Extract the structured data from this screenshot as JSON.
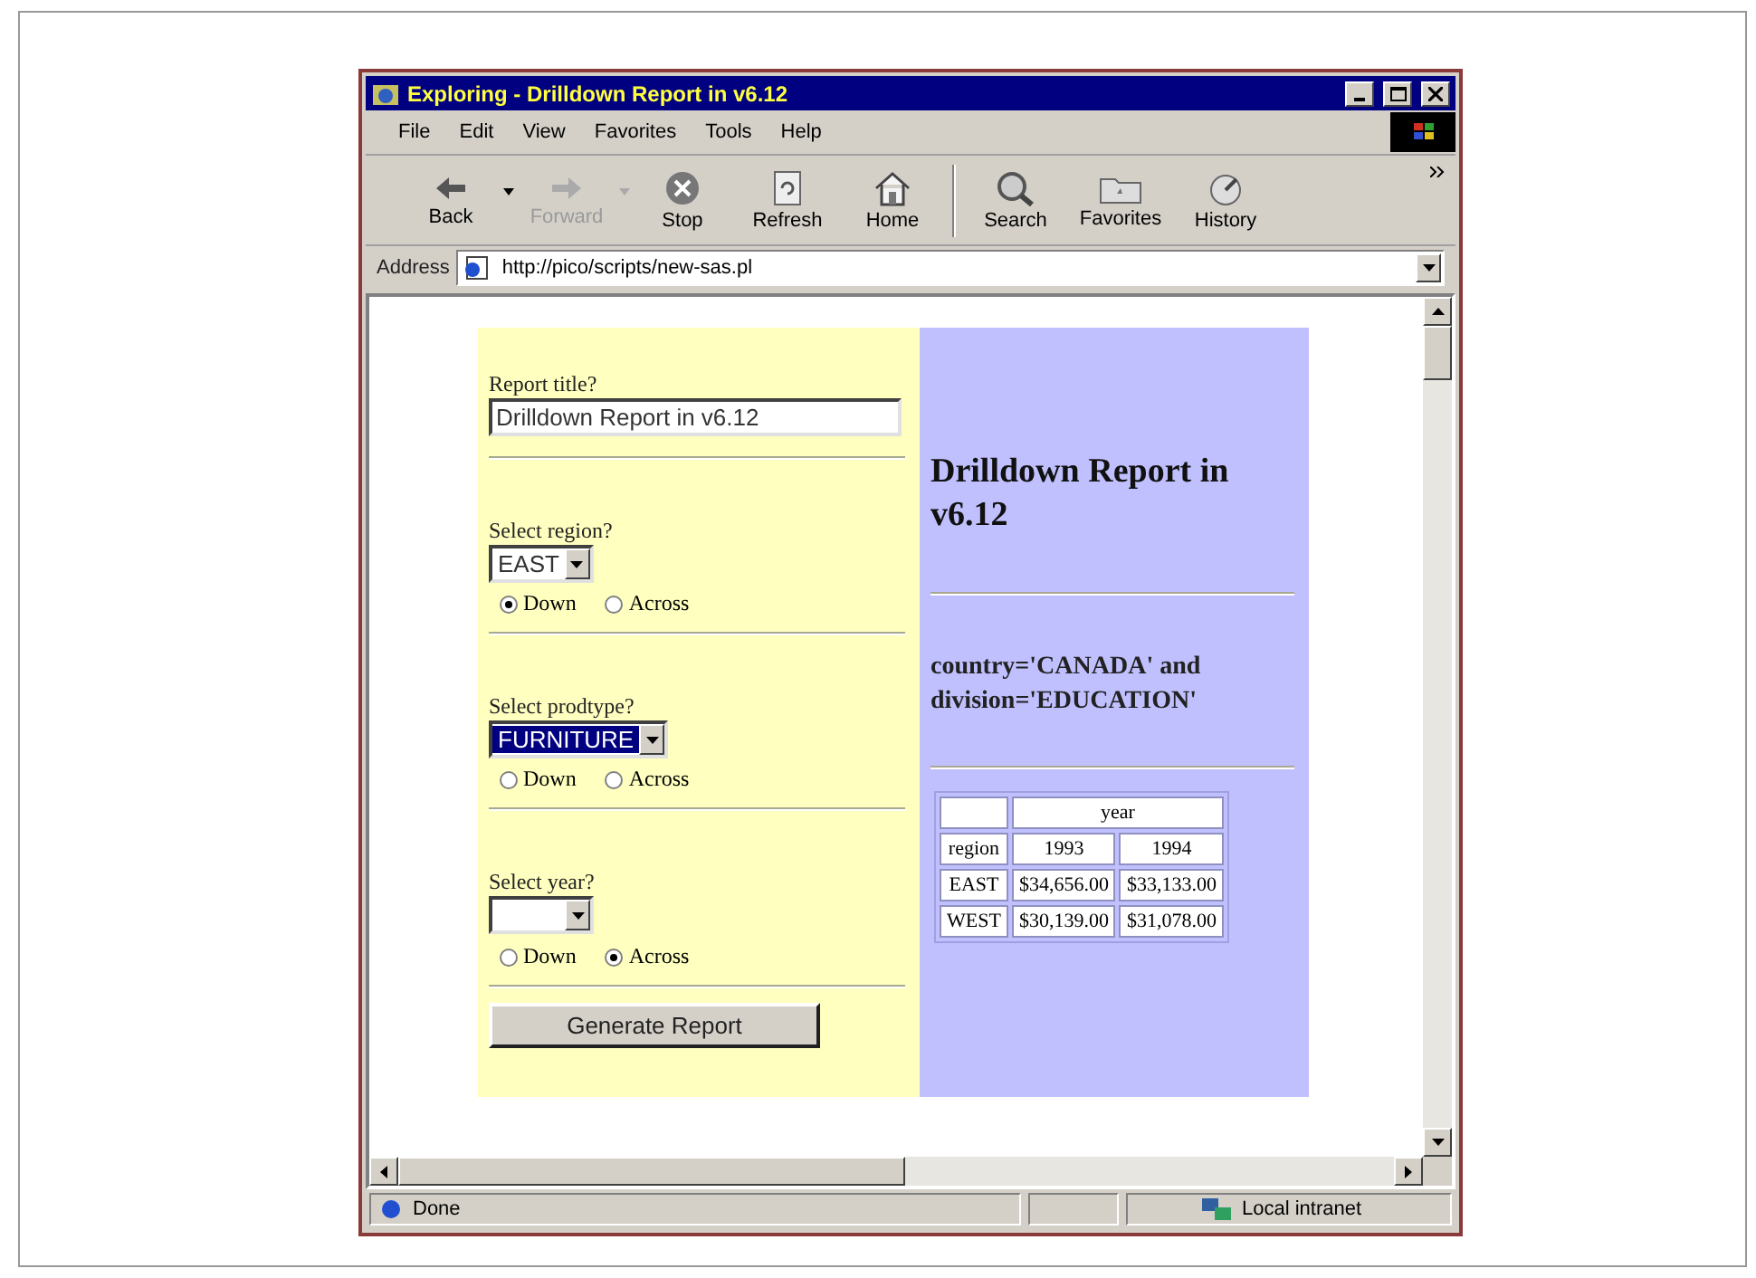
{
  "window": {
    "title": "Exploring - Drilldown Report in v6.12"
  },
  "menu": [
    "File",
    "Edit",
    "View",
    "Favorites",
    "Tools",
    "Help"
  ],
  "toolbar": {
    "groups": [
      [
        {
          "label": "Back",
          "kind": "back",
          "disabled": false,
          "has_menu": true
        },
        {
          "label": "Forward",
          "kind": "forward",
          "disabled": true,
          "has_menu": true
        },
        {
          "label": "Stop",
          "kind": "stop",
          "disabled": false,
          "has_menu": false
        },
        {
          "label": "Refresh",
          "kind": "refresh",
          "disabled": false,
          "has_menu": false
        },
        {
          "label": "Home",
          "kind": "home",
          "disabled": false,
          "has_menu": false
        }
      ],
      [
        {
          "label": "Search",
          "kind": "search",
          "disabled": false,
          "has_menu": false
        },
        {
          "label": "Favorites",
          "kind": "favorites",
          "disabled": false,
          "has_menu": false
        },
        {
          "label": "History",
          "kind": "history",
          "disabled": false,
          "has_menu": false
        }
      ]
    ]
  },
  "address": {
    "label": "Address",
    "value": "http://pico/scripts/new-sas.pl"
  },
  "form": {
    "title_field": {
      "label": "Report title?",
      "value": "Drilldown Report in v6.12"
    },
    "selects": [
      {
        "label": "Select region?",
        "value": "EAST",
        "highlighted": false,
        "options": [
          {
            "label": "Down",
            "selected": true
          },
          {
            "label": "Across",
            "selected": false
          }
        ]
      },
      {
        "label": "Select prodtype?",
        "value": "FURNITURE",
        "highlighted": true,
        "options": [
          {
            "label": "Down",
            "selected": false
          },
          {
            "label": "Across",
            "selected": false
          }
        ]
      },
      {
        "label": "Select year?",
        "highlighted": false,
        "options": [
          {
            "label": "Down",
            "selected": false
          },
          {
            "label": "Across",
            "selected": true
          }
        ]
      }
    ],
    "button": "Generate Report"
  },
  "report": {
    "heading": "Drilldown Report in v6.12",
    "where": "country='CANADA' and division='EDUCATION'",
    "table": {
      "column_group": "year",
      "row_header": "region",
      "columns": [
        "1993",
        "1994"
      ],
      "rows": [
        {
          "label": "EAST",
          "values": [
            "$34,656.00",
            "$33,133.00"
          ]
        },
        {
          "label": "WEST",
          "values": [
            "$30,139.00",
            "$31,078.00"
          ]
        }
      ]
    }
  },
  "status_bar": {
    "text": "Done",
    "zone": "Local intranet"
  }
}
